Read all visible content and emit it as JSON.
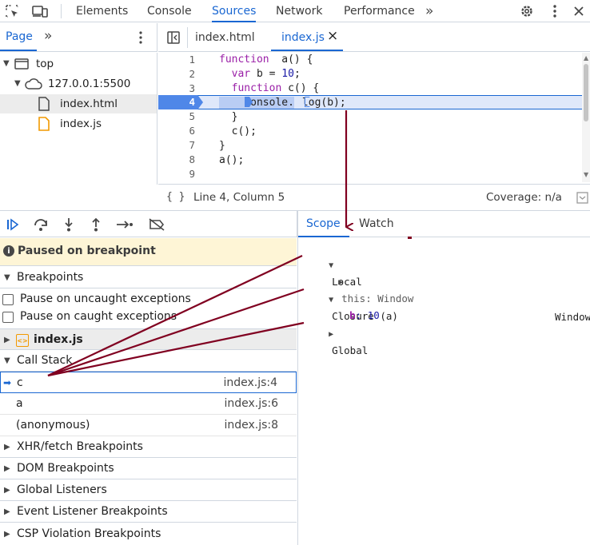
{
  "toolbar": {
    "tabs": [
      {
        "label": "Elements"
      },
      {
        "label": "Console"
      },
      {
        "label": "Sources"
      },
      {
        "label": "Network"
      },
      {
        "label": "Performance"
      }
    ],
    "more_tabs_glyph": "»",
    "icons": [
      "inspect-element-icon",
      "device-toggle-icon",
      "more-tabs-icon",
      "settings-gear-icon",
      "kebab-menu-icon",
      "close-icon"
    ]
  },
  "navigator": {
    "tab_label": "Page",
    "more_glyph": "»",
    "tree": [
      {
        "label": "top",
        "icon": "frame-icon"
      },
      {
        "label": "127.0.0.1:5500",
        "icon": "cloud-icon"
      },
      {
        "label": "index.html",
        "icon": "file-icon"
      },
      {
        "label": "index.js",
        "icon": "js-file-icon"
      }
    ]
  },
  "editor": {
    "tabs": [
      {
        "label": "index.html"
      },
      {
        "label": "index.js"
      }
    ],
    "active_tab": "index.js",
    "close_glyph": "×",
    "lines": [
      {
        "n": "1",
        "tokens": [
          [
            "kw",
            "function"
          ],
          [
            "",
            "  a() {"
          ]
        ]
      },
      {
        "n": "2",
        "tokens": [
          [
            "",
            "  "
          ],
          [
            "kw",
            "var"
          ],
          [
            "",
            " b = "
          ],
          [
            "num",
            "10"
          ],
          [
            "",
            ";"
          ]
        ]
      },
      {
        "n": "3",
        "tokens": [
          [
            "",
            "  "
          ],
          [
            "kw",
            "function"
          ],
          [
            "",
            " c() {"
          ]
        ]
      },
      {
        "n": "4",
        "tokens": [
          [
            "",
            "    console."
          ],
          [
            "",
            "log(b);"
          ]
        ]
      },
      {
        "n": "5",
        "tokens": [
          [
            "",
            "  }"
          ]
        ]
      },
      {
        "n": "6",
        "tokens": [
          [
            "",
            "  c();"
          ]
        ]
      },
      {
        "n": "7",
        "tokens": [
          [
            "",
            "}"
          ]
        ]
      },
      {
        "n": "8",
        "tokens": [
          [
            "",
            "a();"
          ]
        ]
      },
      {
        "n": "9",
        "tokens": [
          [
            "",
            ""
          ]
        ]
      }
    ],
    "breakpoint_line": "4",
    "status_braces": "{ }",
    "status_position": "Line 4, Column 5",
    "status_coverage": "Coverage: n/a"
  },
  "debugger": {
    "paused_message": "Paused on breakpoint",
    "breakpoints_title": "Breakpoints",
    "pause_uncaught": "Pause on uncaught exceptions",
    "pause_caught": "Pause on caught exceptions",
    "breakpoint_file": "index.js",
    "call_stack_title": "Call Stack",
    "call_stack": [
      {
        "name": "c",
        "loc": "index.js:4"
      },
      {
        "name": "a",
        "loc": "index.js:6"
      },
      {
        "name": "(anonymous)",
        "loc": "index.js:8"
      }
    ],
    "sections": [
      "XHR/fetch Breakpoints",
      "DOM Breakpoints",
      "Global Listeners",
      "Event Listener Breakpoints",
      "CSP Violation Breakpoints"
    ]
  },
  "scope": {
    "tabs": [
      {
        "label": "Scope"
      },
      {
        "label": "Watch"
      }
    ],
    "local_label": "Local",
    "this_key": "this",
    "this_value": ": Window",
    "closure_label": "Closure (a)",
    "b_key": "b",
    "b_value": ": 10",
    "global_label": "Global",
    "global_value": "Window"
  },
  "colors": {
    "accent": "#1a67d2",
    "paused_bg": "#fef5d6",
    "annotation_arrow": "#800020",
    "keyword": "#9a1fa7",
    "number": "#1a1aa6"
  }
}
